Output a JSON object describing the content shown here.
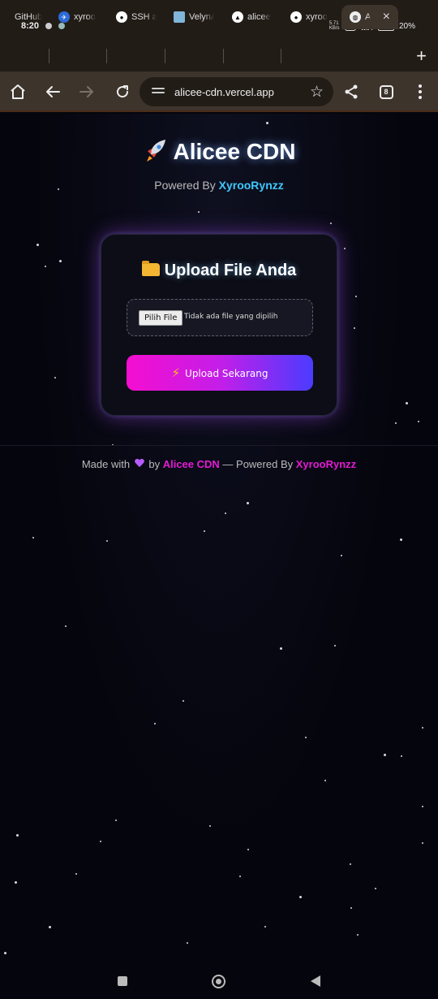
{
  "status_bar": {
    "time": "8:20",
    "network_label": "WiFi",
    "battery": "20%"
  },
  "tabs": [
    {
      "label": "GitHub",
      "icon": "github-icon"
    },
    {
      "label": "xyroo",
      "icon": "bird-icon"
    },
    {
      "label": "SSH a",
      "icon": "github-icon"
    },
    {
      "label": "VelynA",
      "icon": "image-icon"
    },
    {
      "label": "alicee",
      "icon": "vercel-triangle-icon"
    },
    {
      "label": "xyroo",
      "icon": "github-icon"
    },
    {
      "label": "Ali",
      "icon": "globe-icon",
      "active": true
    }
  ],
  "toolbar": {
    "url": "alicee-cdn.vercel.app",
    "tab_count": "8"
  },
  "page": {
    "title": "Alicee CDN",
    "subtitle_prefix": "Powered By ",
    "subtitle_brand": "XyrooRynzz",
    "card_title": "Upload File Anda",
    "file_button": "Pilih File",
    "file_status": "Tidak ada file yang dipilih",
    "upload_button": "Upload Sekarang",
    "footer": {
      "made_with": "Made with",
      "by": "by",
      "site": "Alicee CDN",
      "powered": "— Powered By",
      "author": "XyrooRynzz"
    }
  },
  "colors": {
    "accent_cyan": "#3ec8ff",
    "accent_pink": "#e31bd4",
    "button_gradient_start": "#f40ed0",
    "button_gradient_end": "#4a3cff"
  }
}
